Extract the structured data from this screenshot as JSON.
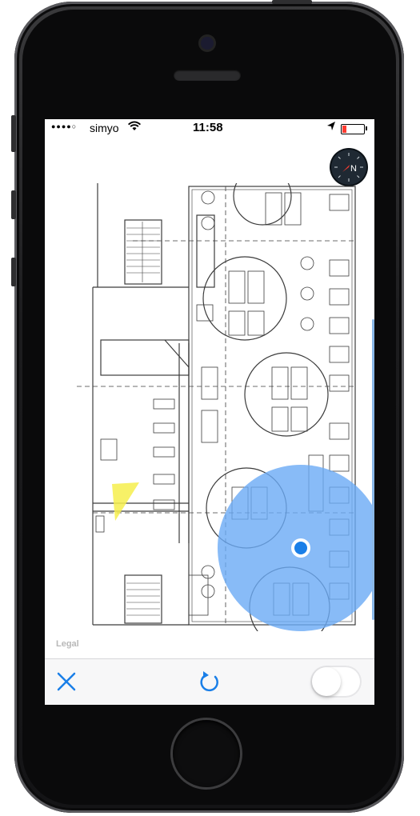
{
  "status_bar": {
    "signal_dots": "●●●●○",
    "carrier": "simyo",
    "time": "11:58",
    "battery_level": 0.2,
    "battery_color": "#ff3b30"
  },
  "compass": {
    "label": "N"
  },
  "map": {
    "legal_label": "Legal",
    "location_accuracy_color": "#6aaaf5",
    "location_dot_color": "#1a7fe8"
  },
  "toolbar": {
    "close_icon": "close-icon",
    "refresh_icon": "refresh-icon",
    "toggle_on": false,
    "accent_color": "#1a7fe8"
  }
}
